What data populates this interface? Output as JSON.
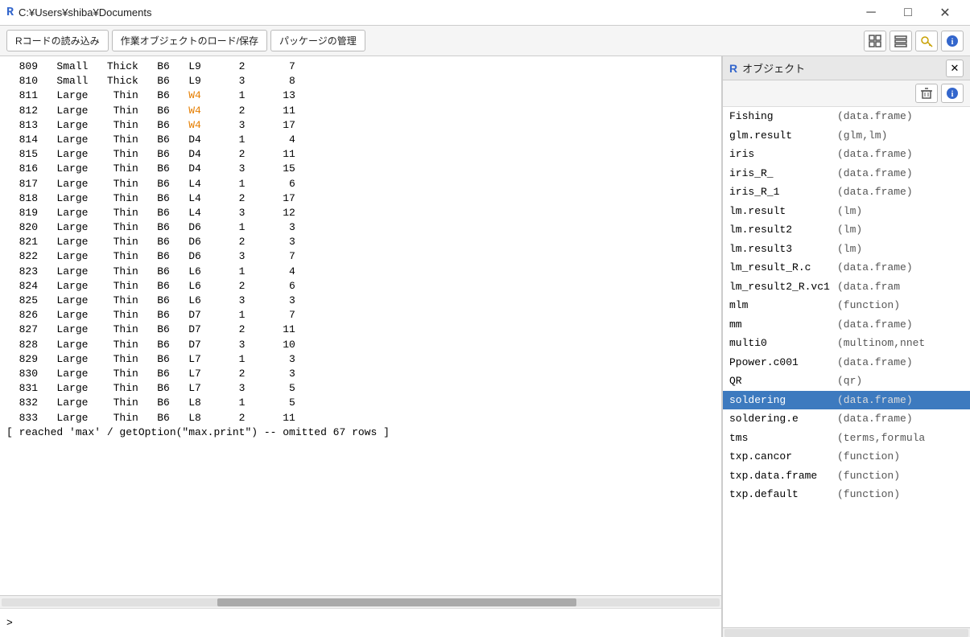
{
  "titleBar": {
    "icon": "R",
    "path": "C:¥Users¥shiba¥Documents",
    "minimizeLabel": "─",
    "maximizeLabel": "□",
    "closeLabel": "✕"
  },
  "toolbar": {
    "btn1": "Rコードの読み込み",
    "btn2": "作業オブジェクトのロード/保存",
    "btn3": "パッケージの管理",
    "iconGrid": "▦",
    "iconList": "☰",
    "iconKey": "🔑",
    "iconInfo": "ℹ"
  },
  "consoleLines": [
    "  809   Small   Thick   B6   L9      2       7",
    "  810   Small   Thick   B6   L9      3       8",
    "  811   Large    Thin   B6   W4      1      13",
    "  812   Large    Thin   B6   W4      2      11",
    "  813   Large    Thin   B6   W4      3      17",
    "  814   Large    Thin   B6   D4      1       4",
    "  815   Large    Thin   B6   D4      2      11",
    "  816   Large    Thin   B6   D4      3      15",
    "  817   Large    Thin   B6   L4      1       6",
    "  818   Large    Thin   B6   L4      2      17",
    "  819   Large    Thin   B6   L4      3      12",
    "  820   Large    Thin   B6   D6      1       3",
    "  821   Large    Thin   B6   D6      2       3",
    "  822   Large    Thin   B6   D6      3       7",
    "  823   Large    Thin   B6   L6      1       4",
    "  824   Large    Thin   B6   L6      2       6",
    "  825   Large    Thin   B6   L6      3       3",
    "  826   Large    Thin   B6   D7      1       7",
    "  827   Large    Thin   B6   D7      2      11",
    "  828   Large    Thin   B6   D7      3      10",
    "  829   Large    Thin   B6   L7      1       3",
    "  830   Large    Thin   B6   L7      2       3",
    "  831   Large    Thin   B6   L7      3       5",
    "  832   Large    Thin   B6   L8      1       5",
    "  833   Large    Thin   B6   L8      2      11"
  ],
  "highlightCells": [
    {
      "line": 2,
      "col": "W4"
    },
    {
      "line": 3,
      "col": "W4"
    },
    {
      "line": 4,
      "col": "W4"
    }
  ],
  "omittedMessage": "[ reached 'max' / getOption(\"max.print\") -- omitted 67 rows ]",
  "objectPanel": {
    "title": "オブジェクト",
    "closeLabel": "✕",
    "deleteIcon": "🗑",
    "infoIcon": "ℹ",
    "objects": [
      {
        "name": "Fishing",
        "type": "(data.frame)"
      },
      {
        "name": "glm.result",
        "type": "(glm,lm)"
      },
      {
        "name": "iris",
        "type": "(data.frame)"
      },
      {
        "name": "iris_R_",
        "type": "(data.frame)"
      },
      {
        "name": "iris_R_1",
        "type": "(data.frame)"
      },
      {
        "name": "lm.result",
        "type": "(lm)"
      },
      {
        "name": "lm.result2",
        "type": "(lm)"
      },
      {
        "name": "lm.result3",
        "type": "(lm)"
      },
      {
        "name": "lm_result_R.c",
        "type": "(data.frame)"
      },
      {
        "name": "lm_result2_R.vc1",
        "type": "(data.fram"
      },
      {
        "name": "mlm",
        "type": "(function)"
      },
      {
        "name": "mm",
        "type": "(data.frame)"
      },
      {
        "name": "multi0",
        "type": "(multinom,nnet"
      },
      {
        "name": "Ppower.c001",
        "type": "(data.frame)"
      },
      {
        "name": "QR",
        "type": "(qr)"
      },
      {
        "name": "soldering",
        "type": "(data.frame)",
        "selected": true
      },
      {
        "name": "soldering.e",
        "type": "(data.frame)"
      },
      {
        "name": "tms",
        "type": "(terms,formula"
      },
      {
        "name": "txp.cancor",
        "type": "(function)"
      },
      {
        "name": "txp.data.frame",
        "type": "(function)"
      },
      {
        "name": "txp.default",
        "type": "(function)"
      }
    ]
  },
  "prompt": ">",
  "inputValue": ""
}
